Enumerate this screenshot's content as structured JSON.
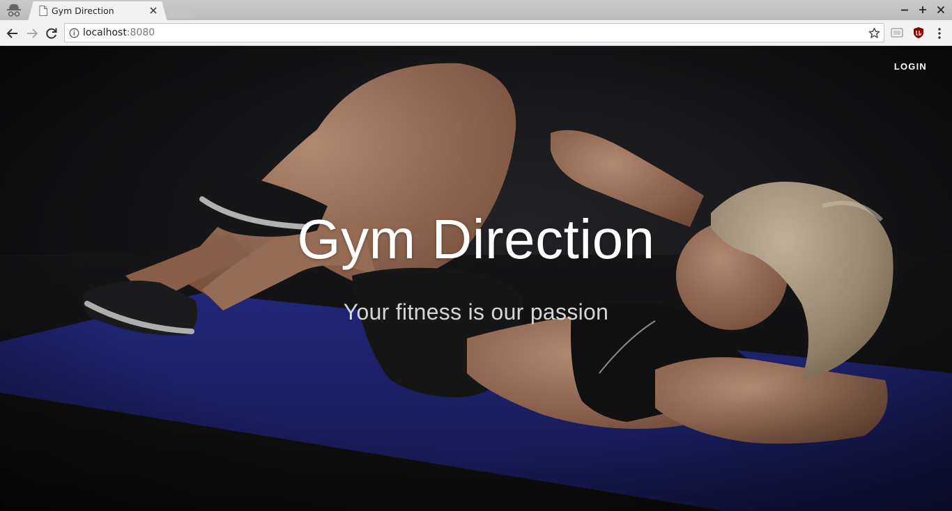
{
  "browser": {
    "tab_title": "Gym Direction",
    "url_host": "localhost",
    "url_port": ":8080"
  },
  "nav": {
    "login_label": "LOGIN"
  },
  "hero": {
    "title": "Gym Direction",
    "subtitle": "Your fitness is our passion"
  },
  "colors": {
    "mat": "#2b2f8f",
    "background": "#141416",
    "text": "#ffffff"
  },
  "icons": {
    "incognito": "incognito-icon",
    "page": "page-icon",
    "close": "close-icon",
    "back": "back-arrow-icon",
    "forward": "forward-arrow-icon",
    "reload": "reload-icon",
    "info": "info-icon",
    "star": "star-icon",
    "menu": "menu-dots-icon"
  }
}
